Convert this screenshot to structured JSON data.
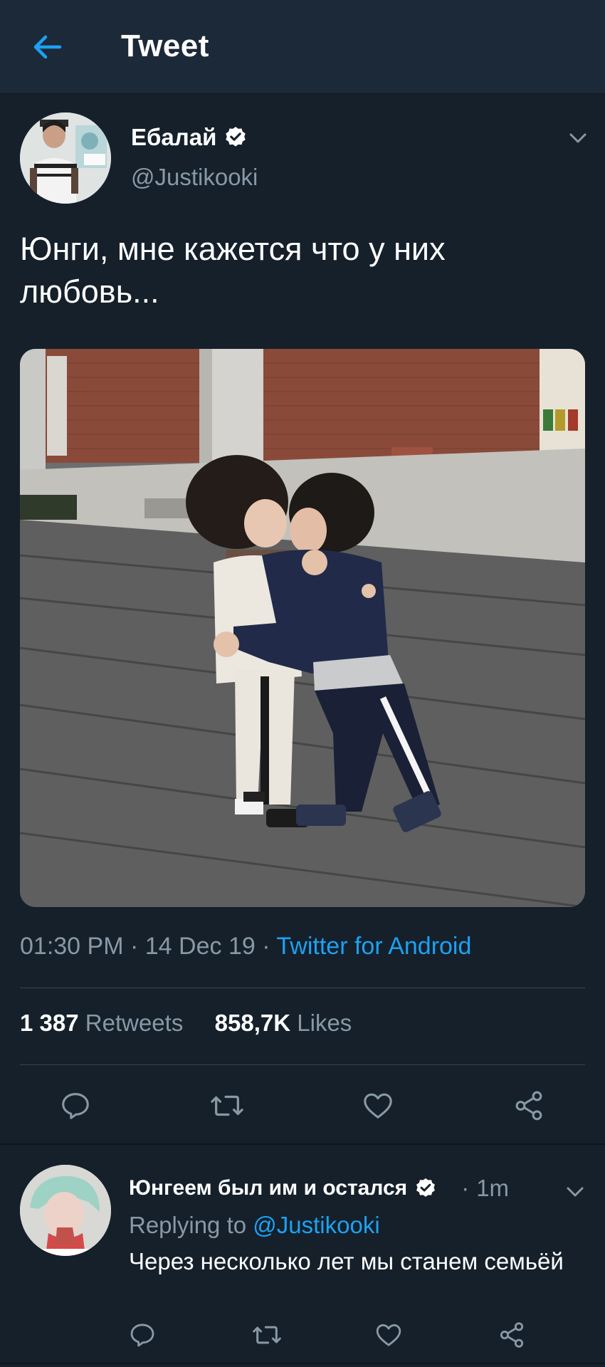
{
  "header": {
    "back_icon": "arrow-left-icon",
    "title": "Tweet"
  },
  "tweet": {
    "author": {
      "display_name": "Ебалай",
      "handle": "@Justikooki",
      "verified": true
    },
    "text": "Юнги, мне кажется что у них любовь...",
    "meta": {
      "time": "01:30 PM",
      "date": "14 Dec 19",
      "separator": "·",
      "source": "Twitter for Android"
    },
    "stats": {
      "retweets_count": "1 387",
      "retweets_label": "Retweets",
      "likes_count": "858,7K",
      "likes_label": "Likes"
    },
    "actions": [
      "reply-icon",
      "retweet-icon",
      "like-icon",
      "share-icon"
    ]
  },
  "reply": {
    "author": {
      "display_name": "Юнгеем был им и остался",
      "verified": true
    },
    "time_sep": "·",
    "time": "1m",
    "replying_label": "Replying to",
    "replying_handle": "@Justikooki",
    "text": "Через несколько лет мы станем семьёй"
  },
  "colors": {
    "background": "#15202b",
    "header_bg": "#1c2938",
    "accent": "#1da1f2",
    "muted_text": "#8899a6",
    "divider": "#38444d"
  }
}
